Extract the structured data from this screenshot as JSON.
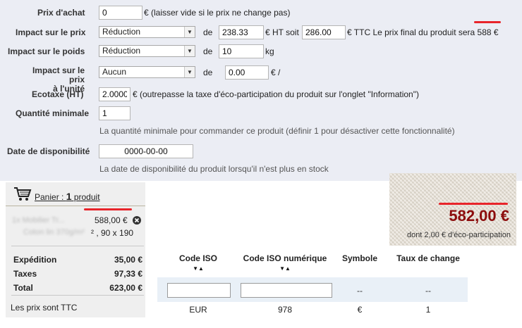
{
  "form": {
    "purchase_price": {
      "label": "Prix d'achat",
      "value": "0",
      "note": "€ (laisser vide si le prix ne change pas)"
    },
    "price_impact": {
      "label": "Impact sur le prix",
      "select": "Réduction",
      "de": "de",
      "value": "238.33",
      "ht_text": "€ HT soit",
      "ttc_value": "286.00",
      "ttc_text": "€ TTC Le prix final du produit sera 588 €"
    },
    "weight_impact": {
      "label": "Impact sur le poids",
      "select": "Réduction",
      "de": "de",
      "value": "10",
      "unit": "kg"
    },
    "unit_price_impact": {
      "label_line1": "Impact sur le prix",
      "label_line2": "à l'unité",
      "select": "Aucun",
      "de": "de",
      "value": "0.00",
      "unit": "€ /"
    },
    "ecotax": {
      "label": "Ecotaxe (HT)",
      "value": "2.00000",
      "note": "€ (outrepasse la taxe d'éco-participation du produit sur l'onglet \"Information\")"
    },
    "min_qty": {
      "label": "Quantité minimale",
      "value": "1",
      "hint": "La quantité minimale pour commander ce produit (définir 1 pour désactiver cette fonctionnalité)"
    },
    "availability": {
      "label": "Date de disponibilité",
      "value": "0000-00-00",
      "hint": "La date de disponibilité du produit lorsqu'il n'est plus en stock"
    }
  },
  "cart": {
    "title_prefix": "Panier : ",
    "count": "1",
    "title_suffix": " produit",
    "item_name_blurred": "1x Mobilier Tr...",
    "item_desc_blurred": "Coton lin 370g/m²",
    "item_price": "588,00 €",
    "item_size": "² , 90 x 190",
    "shipping_label": "Expédition",
    "shipping_value": "35,00 €",
    "taxes_label": "Taxes",
    "taxes_value": "97,33 €",
    "total_label": "Total",
    "total_value": "623,00 €",
    "note": "Les prix sont TTC"
  },
  "price_box": {
    "price": "582,00 €",
    "eco": "dont 2,00 € d'éco-participation"
  },
  "currency_table": {
    "headers": [
      "Code ISO",
      "Code ISO numérique",
      "Symbole",
      "Taux de change"
    ],
    "sort_glyph": "▼▲",
    "filter_dash": "--",
    "row": [
      "EUR",
      "978",
      "€",
      "1"
    ]
  },
  "colors": {
    "panel_bg": "#ebedf4",
    "highlight": "#e8242a",
    "price": "#8c0c0c",
    "filter_row": "#e9f0f7"
  }
}
